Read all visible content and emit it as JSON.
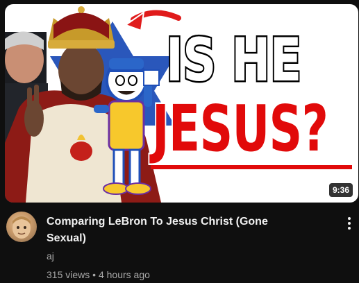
{
  "video": {
    "thumbnail_text_line1": "IS HE",
    "thumbnail_text_line2": "JESUS?",
    "duration": "9:36",
    "title": "Comparing LeBron To Jesus Christ (Gone Sexual)",
    "channel": "aj",
    "views": "315 views",
    "separator": "•",
    "age": "4 hours ago"
  },
  "icons": {
    "menu": "more-vert-icon"
  },
  "colors": {
    "background": "#0f0f0f",
    "title": "#f1f1f1",
    "meta": "#aaaaaa",
    "thumb_red": "#e10a0a",
    "star_blue": "#1f4fb8"
  }
}
